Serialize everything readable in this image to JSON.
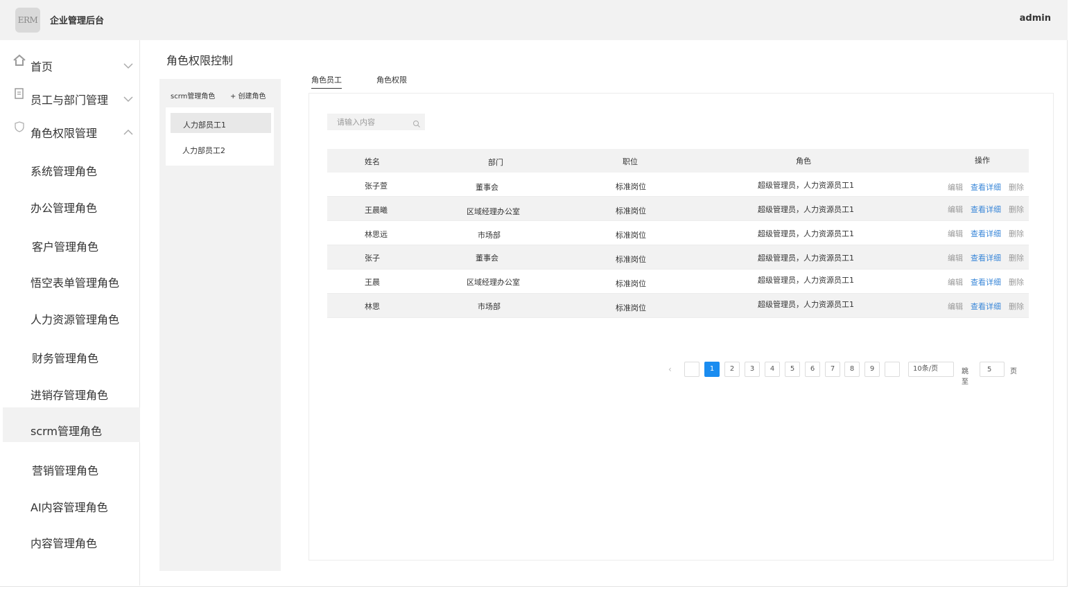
{
  "header": {
    "logo_text": "ERM",
    "title": "企业管理后台",
    "user": "admin"
  },
  "sidebar": {
    "groups": [
      {
        "label": "首页",
        "icon": "home-icon",
        "expanded": false
      },
      {
        "label": "员工与部门管理",
        "icon": "document-icon",
        "expanded": false
      },
      {
        "label": "角色权限管理",
        "icon": "shield-icon",
        "expanded": true
      }
    ],
    "sub_items": [
      {
        "label": "系统管理角色"
      },
      {
        "label": "办公管理角色"
      },
      {
        "label": "客户管理角色"
      },
      {
        "label": "悟空表单管理角色"
      },
      {
        "label": "人力资源管理角色"
      },
      {
        "label": "财务管理角色"
      },
      {
        "label": "进销存管理角色"
      },
      {
        "label": "scrm管理角色",
        "active": true
      },
      {
        "label": "营销管理角色"
      },
      {
        "label": "AI内容管理角色"
      },
      {
        "label": "内容管理角色"
      }
    ]
  },
  "page": {
    "title": "角色权限控制"
  },
  "role_panel": {
    "title": "scrm管理角色",
    "create_label": "+ 创建角色",
    "roles": [
      {
        "label": "人力部员工1",
        "active": true
      },
      {
        "label": "人力部员工2",
        "active": false
      }
    ]
  },
  "tabs": [
    {
      "label": "角色员工",
      "active": true
    },
    {
      "label": "角色权限",
      "active": false
    }
  ],
  "search": {
    "placeholder": "请输入内容",
    "value": ""
  },
  "table": {
    "headers": [
      "姓名",
      "部门",
      "职位",
      "角色",
      "操作"
    ],
    "rows": [
      {
        "name": "张子萱",
        "dept": "董事会",
        "position": "标准岗位",
        "role": "超级管理员，人力资源员工1"
      },
      {
        "name": "王晨曦",
        "dept": "区域经理办公室",
        "position": "标准岗位",
        "role": "超级管理员，人力资源员工1"
      },
      {
        "name": "林思远",
        "dept": "市场部",
        "position": "标准岗位",
        "role": "超级管理员，人力资源员工1"
      },
      {
        "name": "张子",
        "dept": "董事会",
        "position": "标准岗位",
        "role": "超级管理员，人力资源员工1"
      },
      {
        "name": "王晨",
        "dept": "区域经理办公室",
        "position": "标准岗位",
        "role": "超级管理员，人力资源员工1"
      },
      {
        "name": "林思",
        "dept": "市场部",
        "position": "标准岗位",
        "role": "超级管理员，人力资源员工1"
      }
    ],
    "actions": {
      "edit": "编辑",
      "view": "查看详细",
      "delete": "删除"
    },
    "colors": {
      "view_link": "#3a87d8",
      "muted": "#999999"
    }
  },
  "pagination": {
    "prev": "‹",
    "pages": [
      "",
      "1",
      "2",
      "3",
      "4",
      "5",
      "6",
      "7",
      "8",
      "9",
      ""
    ],
    "current": "1",
    "page_size": "10条/页",
    "jump_label": "跳至",
    "jump_value": "5",
    "page_unit": "页",
    "accent": "#1a8cf0"
  }
}
